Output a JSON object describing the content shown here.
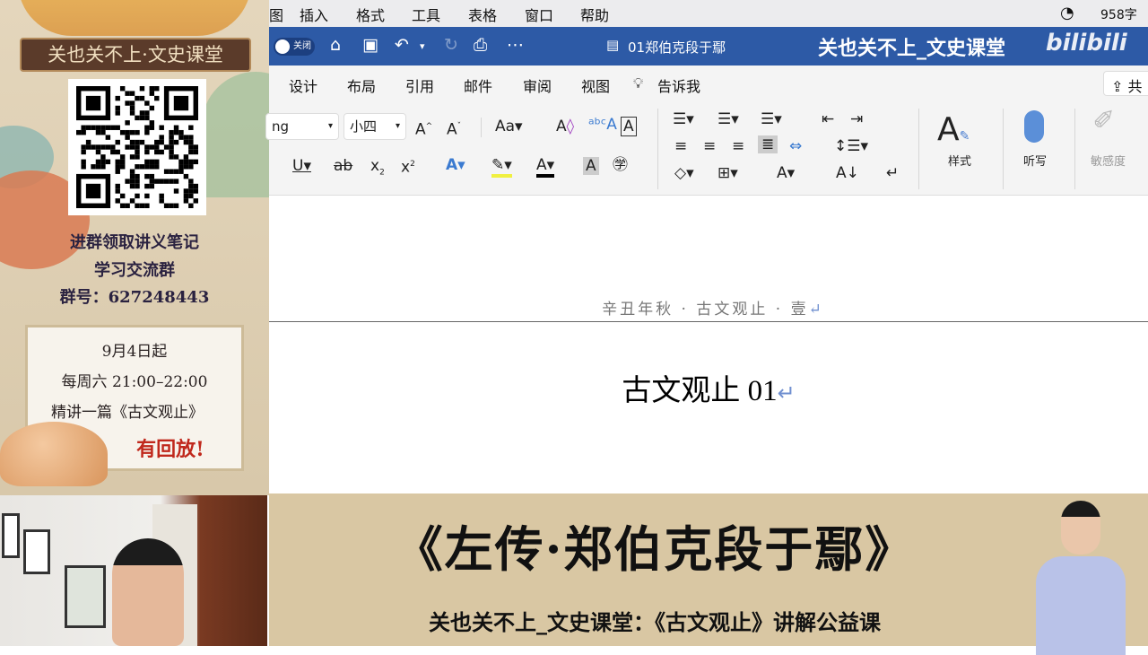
{
  "left_panel": {
    "banner": "关也关不上·文史课堂",
    "lines": [
      "进群领取讲义笔记",
      "学习交流群",
      "群号：627248443"
    ],
    "notice": {
      "date": "9月4日起",
      "schedule": "每周六 21:00–22:00",
      "content": "精讲一篇《古文观止》",
      "replay": "有回放!"
    }
  },
  "menubar": {
    "items": [
      "图",
      "插入",
      "格式",
      "工具",
      "表格",
      "窗口",
      "帮助"
    ],
    "word_count": "958字"
  },
  "titlebar": {
    "autosave": "关闭",
    "doc_title": "01郑伯克段于鄢",
    "watermark": "关也关不上_文史课堂",
    "logo": "bilibili"
  },
  "tabs": [
    "设计",
    "布局",
    "引用",
    "邮件",
    "审阅",
    "视图"
  ],
  "tell_me": "告诉我",
  "share": "共",
  "ribbon": {
    "font": "ng",
    "size": "小四",
    "styles": "样式",
    "dictate": "听写",
    "sensitivity": "敏感度"
  },
  "document": {
    "header": "辛丑年秋 · 古文观止 · 壹",
    "title": "古文观止 01",
    "return_mark": "↵"
  },
  "bottom_banner": {
    "title": "《左传·郑伯克段于鄢》",
    "subtitle": "关也关不上_文史课堂：《古文观止》讲解公益课"
  },
  "colors": {
    "titlebar": "#2d5aa6",
    "banner_bg": "#d9c7a3",
    "panel_text": "#2a2240",
    "replay": "#c0281c"
  }
}
